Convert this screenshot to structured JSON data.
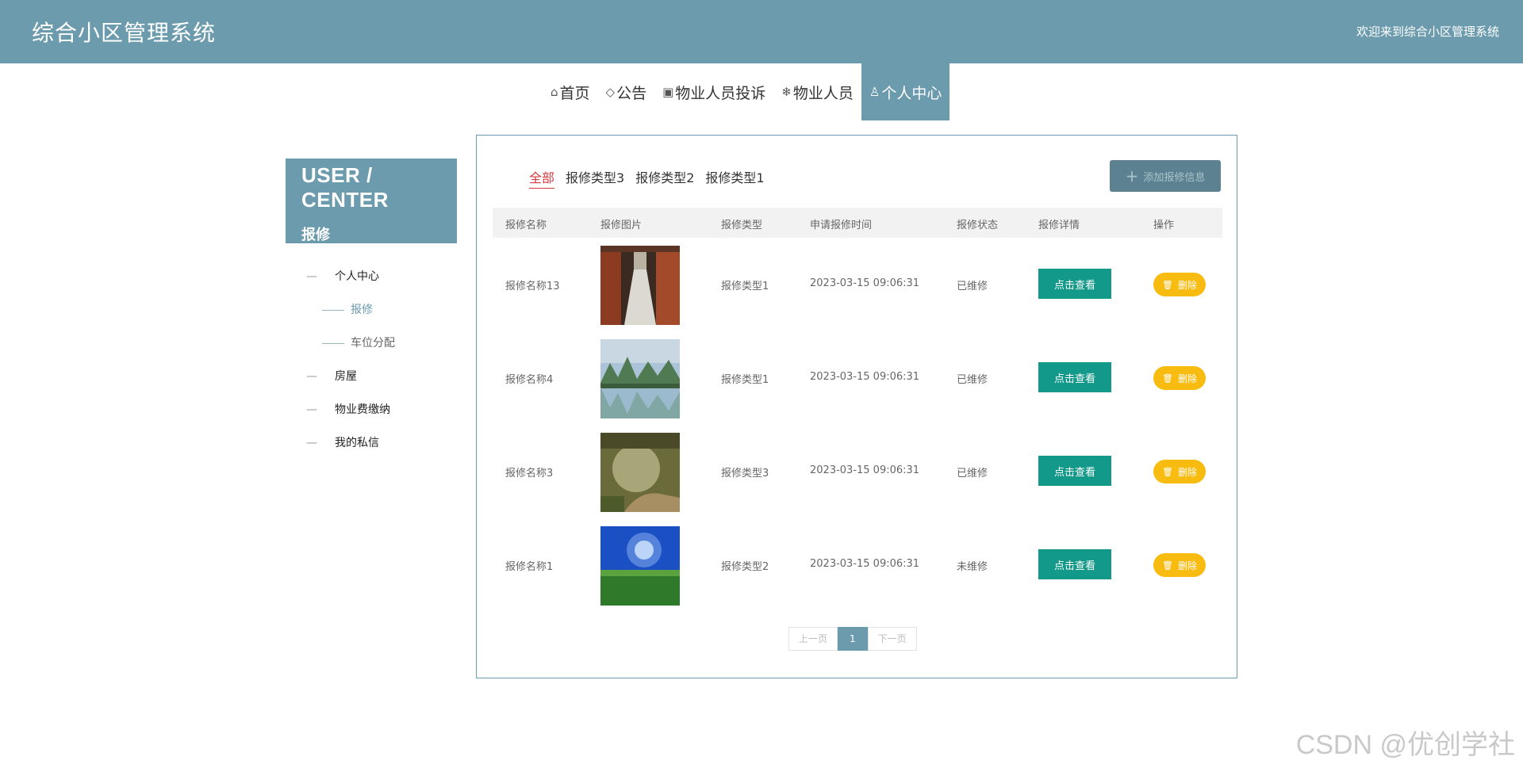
{
  "header": {
    "title": "综合小区管理系统",
    "welcome": "欢迎来到综合小区管理系统"
  },
  "nav": [
    {
      "icon": "home-icon",
      "glyph": "⌂",
      "label": "首页"
    },
    {
      "icon": "tag-icon",
      "glyph": "◇",
      "label": "公告"
    },
    {
      "icon": "clipboard-icon",
      "glyph": "▣",
      "label": "物业人员投诉"
    },
    {
      "icon": "snowflake-icon",
      "glyph": "❄",
      "label": "物业人员"
    },
    {
      "icon": "user-icon",
      "glyph": "♙",
      "label": "个人中心"
    }
  ],
  "sidebar": {
    "title": "USER / CENTER",
    "subtitle": "报修",
    "items": [
      {
        "label": "个人中心"
      },
      {
        "label": "报修"
      },
      {
        "label": "车位分配"
      },
      {
        "label": "房屋"
      },
      {
        "label": "物业费缴纳"
      },
      {
        "label": "我的私信"
      }
    ]
  },
  "filters": [
    "全部",
    "报修类型3",
    "报修类型2",
    "报修类型1"
  ],
  "add_button": "添加报修信息",
  "table": {
    "headers": [
      "报修名称",
      "报修图片",
      "报修类型",
      "申请报修时间",
      "报修状态",
      "报修详情",
      "操作"
    ],
    "rows": [
      {
        "name": "报修名称13",
        "type": "报修类型1",
        "time": "2023-03-15 09:06:31",
        "status": "已维修",
        "view": "点击查看",
        "delete": "删除"
      },
      {
        "name": "报修名称4",
        "type": "报修类型1",
        "time": "2023-03-15 09:06:31",
        "status": "已维修",
        "view": "点击查看",
        "delete": "删除"
      },
      {
        "name": "报修名称3",
        "type": "报修类型3",
        "time": "2023-03-15 09:06:31",
        "status": "已维修",
        "view": "点击查看",
        "delete": "删除"
      },
      {
        "name": "报修名称1",
        "type": "报修类型2",
        "time": "2023-03-15 09:06:31",
        "status": "未维修",
        "view": "点击查看",
        "delete": "删除"
      }
    ]
  },
  "pagination": {
    "prev": "上一页",
    "current": "1",
    "next": "下一页"
  },
  "watermark": "CSDN @优创学社",
  "colors": {
    "primary": "#6b9bad",
    "view_button": "#13998a",
    "delete_button": "#f8bb10",
    "filter_active": "#d9363e"
  }
}
